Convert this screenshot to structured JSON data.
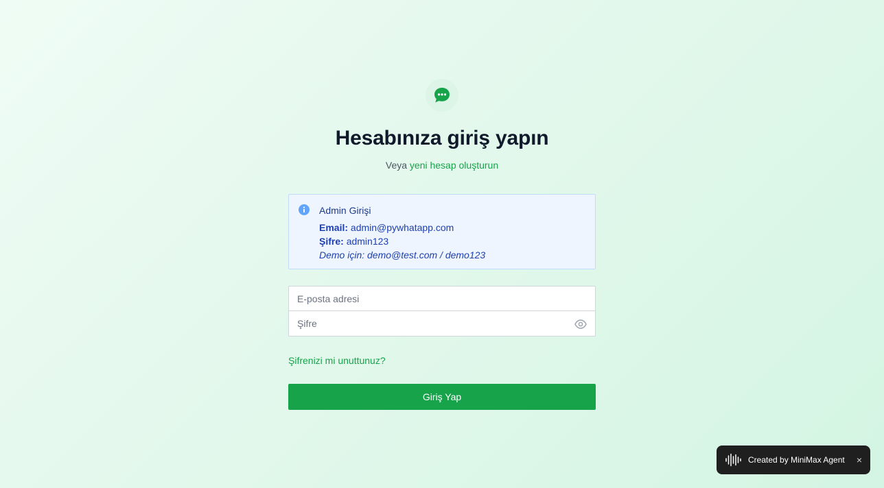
{
  "brand": {
    "icon": "chat-bubble-icon",
    "accent_color": "#16a34a"
  },
  "header": {
    "title": "Hesabınıza giriş yapın",
    "subtitle_prefix": "Veya",
    "register_link": "yeni hesap oluşturun"
  },
  "info": {
    "icon": "info-icon",
    "heading": "Admin Girişi",
    "email_label": "Email:",
    "email_value": "admin@pywhatapp.com",
    "password_label": "Şifre:",
    "password_value": "admin123",
    "demo_text": "Demo için: demo@test.com / demo123"
  },
  "form": {
    "email_placeholder": "E-posta adresi",
    "email_value": "",
    "password_placeholder": "Şifre",
    "password_value": "",
    "toggle_icon": "eye-icon",
    "forgot_link": "Şifrenizi mi unuttunuz?",
    "submit_label": "Giriş Yap"
  },
  "badge": {
    "icon": "waveform-icon",
    "label": "Created by MiniMax Agent",
    "close": "×"
  }
}
